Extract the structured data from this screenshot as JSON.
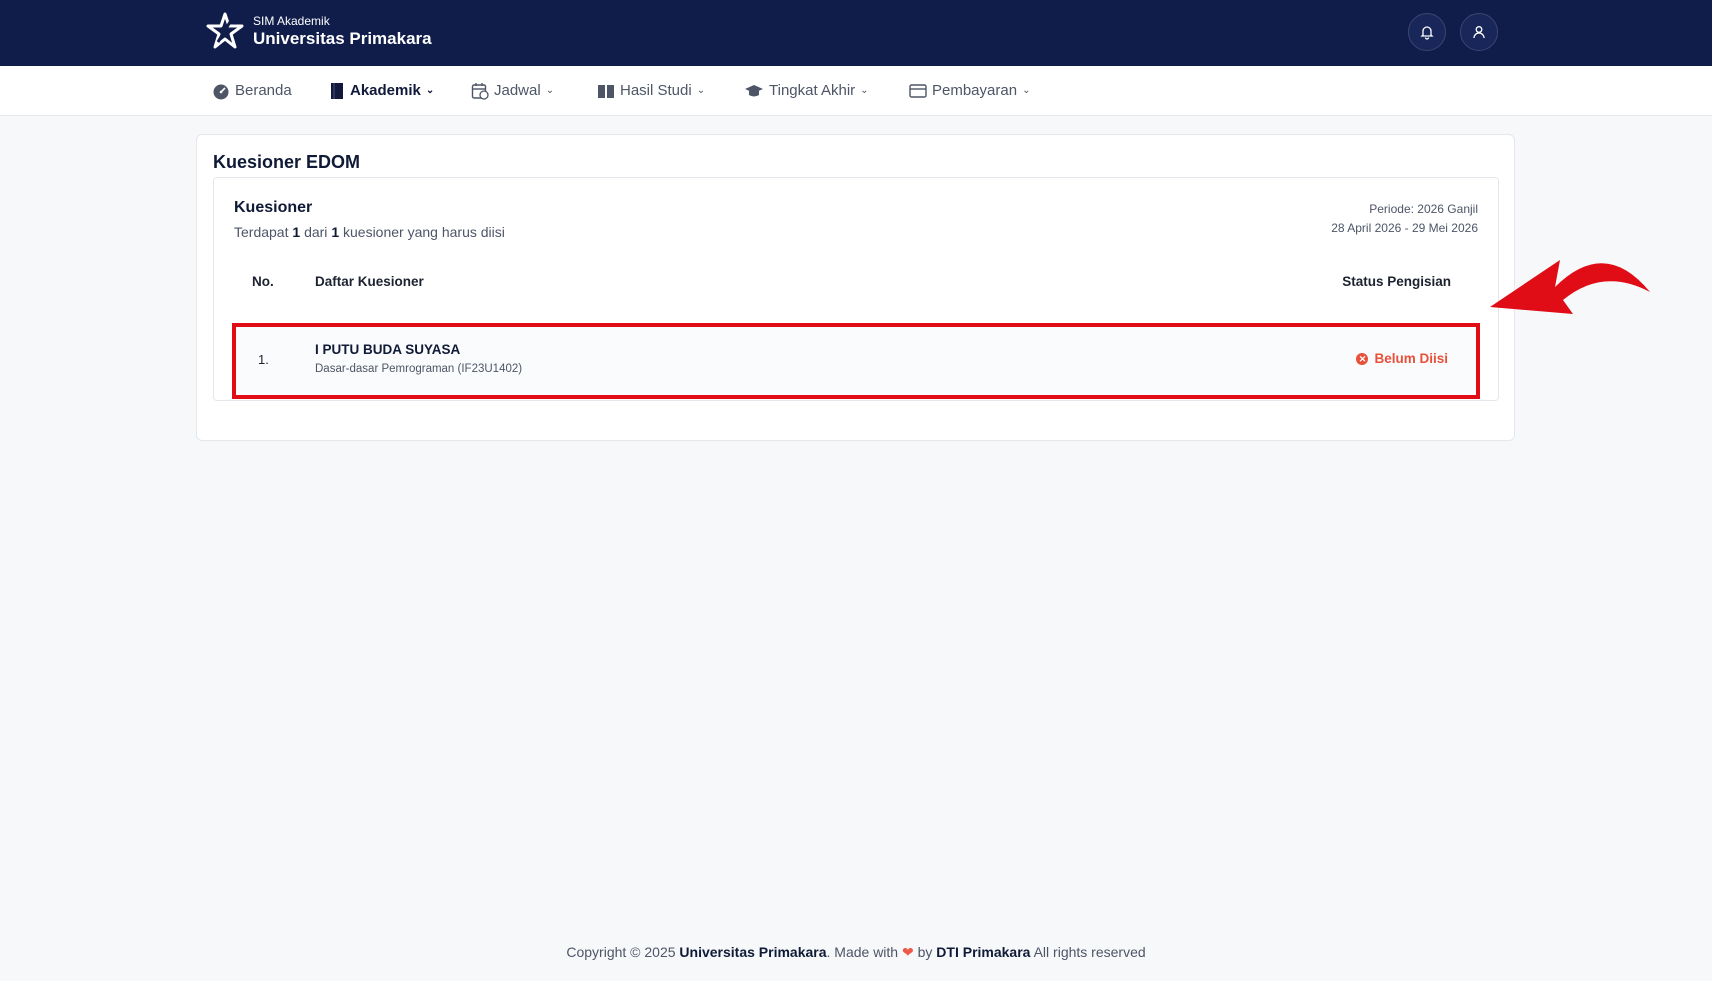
{
  "header": {
    "subtitle": "SIM Akademik",
    "title": "Universitas Primakara",
    "icons": [
      "bell-icon",
      "user-icon"
    ]
  },
  "nav": {
    "items": [
      {
        "label": "Beranda",
        "icon": "dashboard-icon"
      },
      {
        "label": "Akademik",
        "icon": "book-icon",
        "active": true
      },
      {
        "label": "Jadwal",
        "icon": "calendar-icon"
      },
      {
        "label": "Hasil Studi",
        "icon": "book-open-icon"
      },
      {
        "label": "Tingkat Akhir",
        "icon": "graduation-cap-icon"
      },
      {
        "label": "Pembayaran",
        "icon": "card-icon"
      }
    ]
  },
  "page": {
    "title": "Kuesioner EDOM"
  },
  "questionnaire": {
    "title": "Kuesioner",
    "summary_prefix": "Terdapat",
    "count": "1",
    "summary_mid": "dari",
    "total": "1",
    "summary_suffix": "kuesioner yang harus diisi",
    "periode": "Periode: 2026 Ganjil",
    "date_range": "28 April 2026 - 29 Mei 2026",
    "columns": {
      "no": "No.",
      "list": "Daftar Kuesioner",
      "status": "Status Pengisian"
    },
    "rows": [
      {
        "no": "1.",
        "lecturer": "I PUTU BUDA SUYASA",
        "course": "Dasar-dasar Pemrograman (IF23U1402)",
        "status": "Belum Diisi"
      }
    ]
  },
  "footer": {
    "prefix": "Copyright © 2025",
    "org": "Universitas Primakara",
    "made_with": ". Made with",
    "by": "by",
    "team": "DTI Primakara",
    "rights": "All rights reserved"
  },
  "colors": {
    "header_bg": "#101d4b",
    "status_red": "#e8503a",
    "annotation_red": "#e00d16"
  }
}
